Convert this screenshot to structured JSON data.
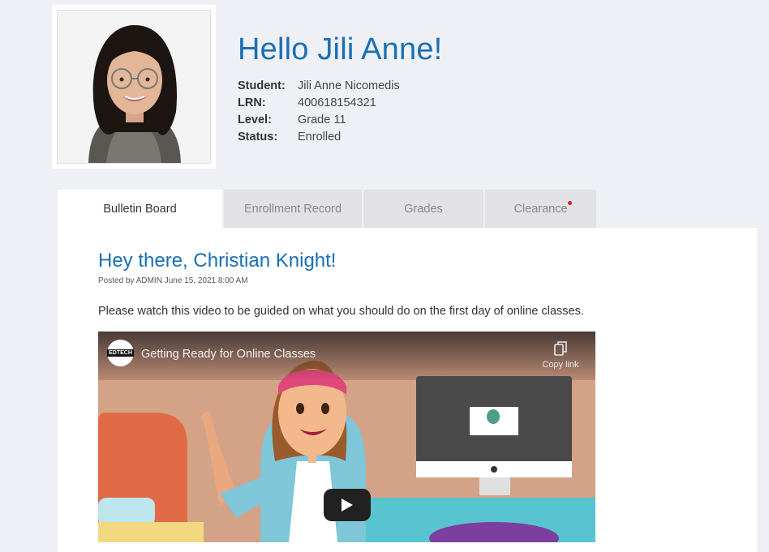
{
  "profile": {
    "greeting": "Hello Jili Anne!",
    "fields": [
      {
        "label": "Student:",
        "value": "Jili Anne Nicomedis"
      },
      {
        "label": "LRN:",
        "value": "400618154321"
      },
      {
        "label": "Level:",
        "value": "Grade 11"
      },
      {
        "label": "Status:",
        "value": "Enrolled"
      }
    ]
  },
  "tabs": [
    {
      "label": "Bulletin Board",
      "active": true
    },
    {
      "label": "Enrollment Record",
      "active": false
    },
    {
      "label": "Grades",
      "active": false
    },
    {
      "label": "Clearance",
      "active": false,
      "notification": true
    }
  ],
  "post": {
    "title": "Hey there, Christian Knight!",
    "meta": "Posted by ADMIN June 15, 2021 8:00 AM",
    "body": "Please watch this video to be guided on what you should do on the first day of online classes."
  },
  "video": {
    "channel_logo_text": "EDTECH",
    "title": "Getting Ready for Online Classes",
    "copy_link_label": "Copy link",
    "icons": {
      "copy": "copy-icon",
      "play": "play-icon"
    }
  },
  "colors": {
    "accent": "#1a6fb5",
    "notification": "#e0201b",
    "page_background": "#eef0f5"
  }
}
